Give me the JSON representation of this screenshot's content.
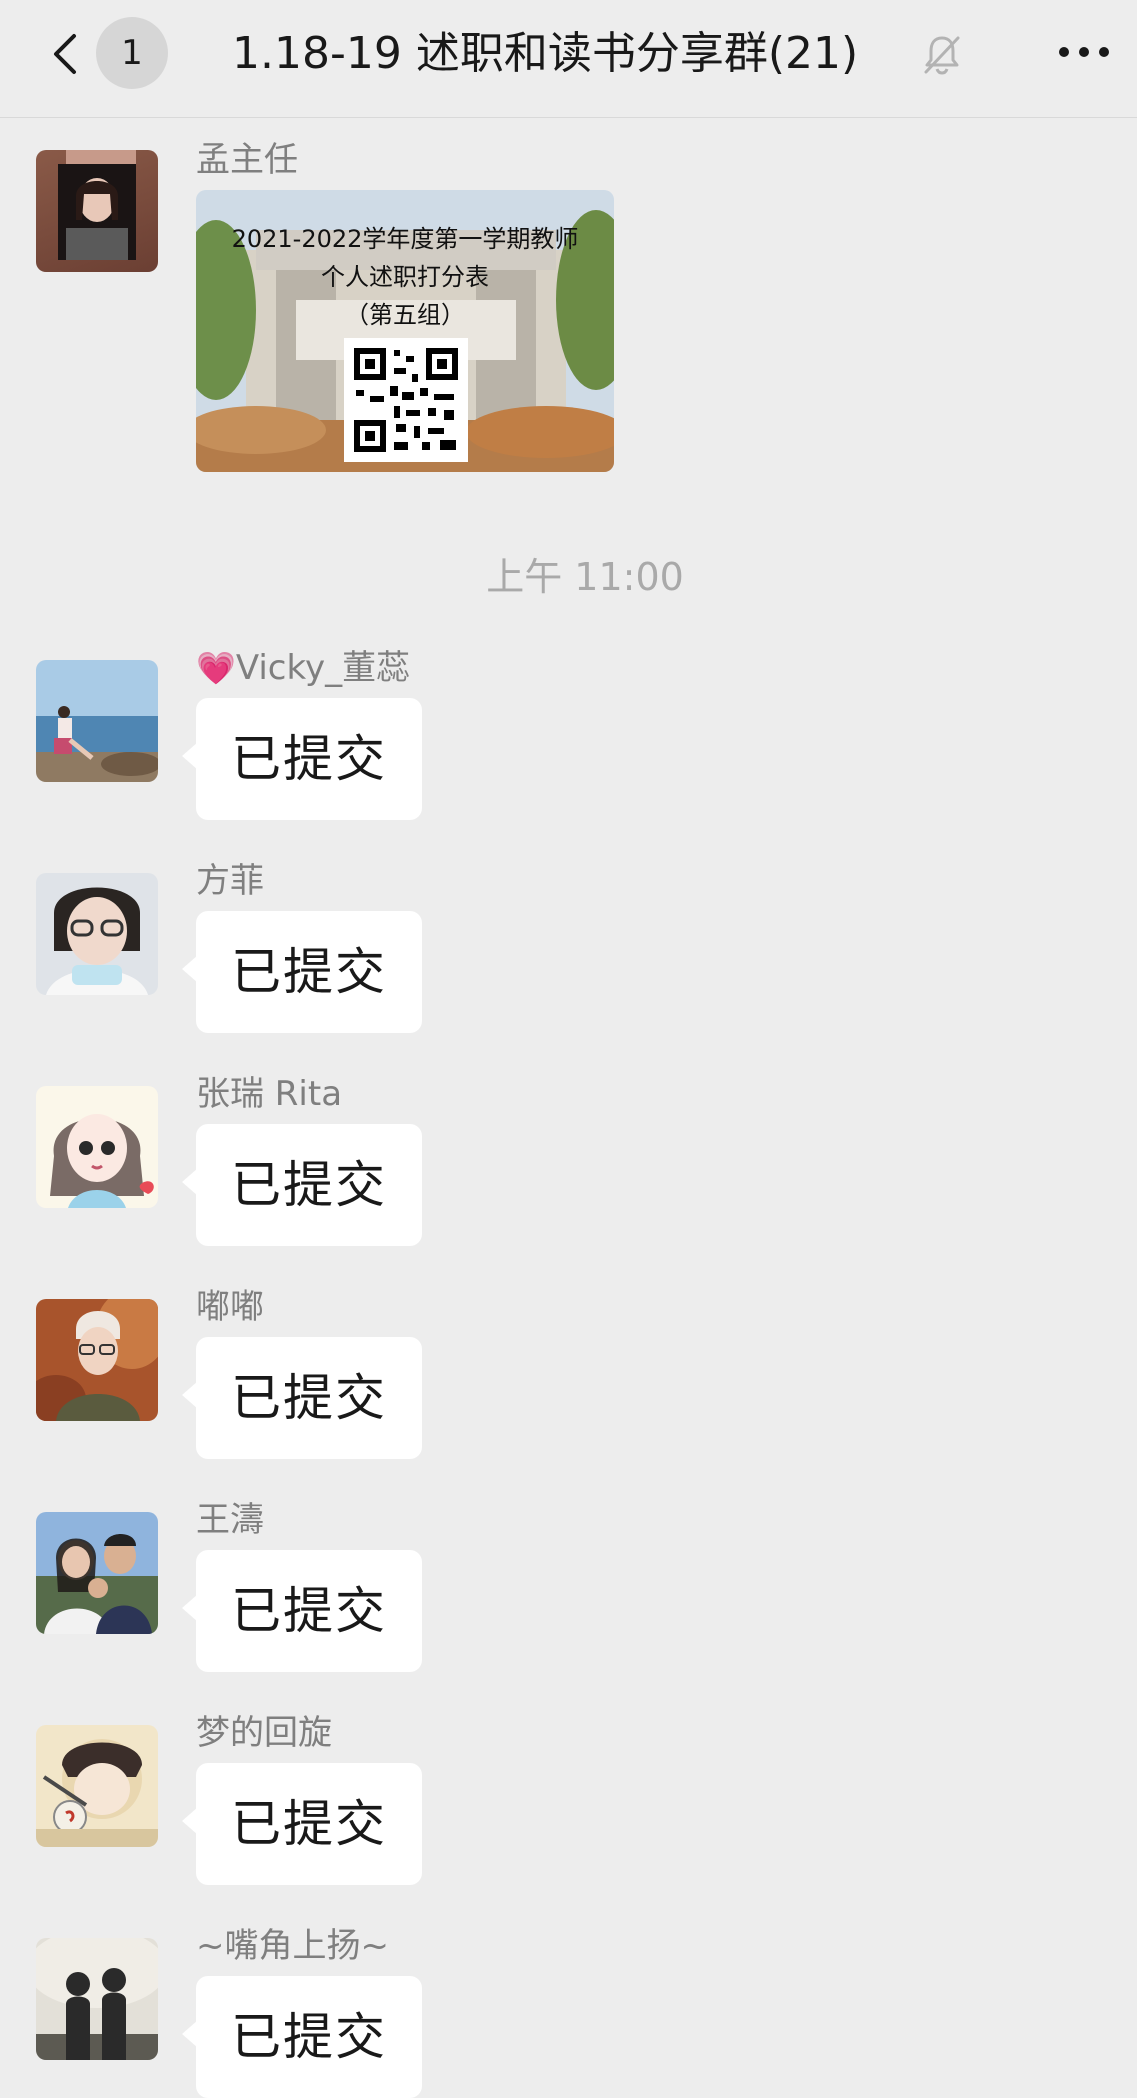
{
  "header": {
    "back_icon": "chevron-left-icon",
    "unread_count": "1",
    "title": "1.18-19 述职和读书分享群(21)",
    "mute_icon": "bell-off-icon",
    "more_icon": "more-dots-icon"
  },
  "first_message": {
    "sender": "孟主任",
    "card": {
      "line1": "2021-2022学年度第一学期教师",
      "line2": "个人述职打分表",
      "line3": "（第五组）"
    }
  },
  "time_divider": "上午 11:00",
  "messages": [
    {
      "sender": "Vicky_董蕊",
      "sender_prefix": "💗",
      "text": "已提交"
    },
    {
      "sender": "方菲",
      "text": "已提交"
    },
    {
      "sender": "张瑞 Rita",
      "text": "已提交"
    },
    {
      "sender": "嘟嘟",
      "text": "已提交"
    },
    {
      "sender": "王濤",
      "text": "已提交"
    },
    {
      "sender": "梦的回旋",
      "text": "已提交"
    },
    {
      "sender": "~嘴角上扬~",
      "text": "已提交"
    }
  ],
  "colors": {
    "background": "#ededed",
    "bubble": "#ffffff",
    "sender_text": "#7f7f7f",
    "time_text": "#a9a9a9",
    "heart": "#ff5c9e"
  }
}
